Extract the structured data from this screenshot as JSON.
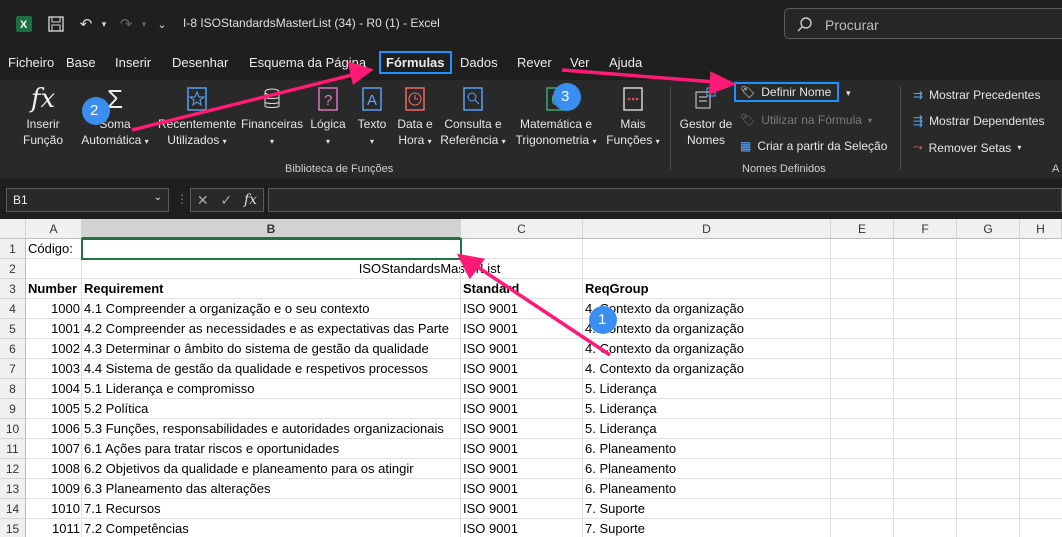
{
  "titlebar": {
    "title": "I-8 ISOStandardsMasterList (34) - R0 (1)  -  Excel",
    "search_placeholder": "Procurar"
  },
  "tabs": [
    "Ficheiro",
    "Base",
    "Inserir",
    "Desenhar",
    "Esquema da Página",
    "Fórmulas",
    "Dados",
    "Rever",
    "Ver",
    "Ajuda"
  ],
  "ribbon": {
    "insert_function": [
      "Inserir",
      "Função"
    ],
    "autosum": [
      "Soma",
      "Automática"
    ],
    "recent": [
      "Recentemente",
      "Utilizados"
    ],
    "financial": "Financeiras",
    "logical": "Lógica",
    "text": "Texto",
    "datetime": [
      "Data e",
      "Hora"
    ],
    "lookup": [
      "Consulta e",
      "Referência"
    ],
    "math": [
      "Matemática e",
      "Trigonometria"
    ],
    "more": [
      "Mais",
      "Funções"
    ],
    "group_library": "Biblioteca de Funções",
    "name_manager": [
      "Gestor de",
      "Nomes"
    ],
    "define_name": "Definir Nome",
    "use_in_formula": "Utilizar na Fórmula",
    "create_from_selection": "Criar a partir da Seleção",
    "group_names": "Nomes Definidos",
    "trace_precedents": "Mostrar Precedentes",
    "trace_dependents": "Mostrar Dependentes",
    "remove_arrows": "Remover Setas",
    "group_audit_partial": "A"
  },
  "formula_bar": {
    "name_box": "B1",
    "fx": "fx"
  },
  "columns": [
    "A",
    "B",
    "C",
    "D",
    "E",
    "F",
    "G",
    "H"
  ],
  "rows": [
    {
      "n": "1",
      "a": "Código:",
      "b": "",
      "c": "",
      "d": ""
    },
    {
      "n": "2",
      "a": "",
      "b": "ISOStandardsMasterList",
      "c": "",
      "d": ""
    },
    {
      "n": "3",
      "a": "Number",
      "b": "Requirement",
      "c": "Standard",
      "d": "ReqGroup"
    },
    {
      "n": "4",
      "a": "1000",
      "b": "4.1 Compreender a organização e o seu contexto",
      "c": "ISO 9001",
      "d": "4. Contexto da organização"
    },
    {
      "n": "5",
      "a": "1001",
      "b": "4.2 Compreender  as necessidades e as expectativas das Parte",
      "c": "ISO 9001",
      "d": "4. Contexto da organização"
    },
    {
      "n": "6",
      "a": "1002",
      "b": "4.3 Determinar o âmbito do sistema de gestão da qualidade",
      "c": "ISO 9001",
      "d": "4. Contexto da organização"
    },
    {
      "n": "7",
      "a": "1003",
      "b": "4.4 Sistema de gestão da qualidade e respetivos processos",
      "c": "ISO 9001",
      "d": "4. Contexto da organização"
    },
    {
      "n": "8",
      "a": "1004",
      "b": "5.1 Liderança e compromisso",
      "c": "ISO 9001",
      "d": "5. Liderança"
    },
    {
      "n": "9",
      "a": "1005",
      "b": "5.2 Política",
      "c": "ISO 9001",
      "d": "5. Liderança"
    },
    {
      "n": "10",
      "a": "1006",
      "b": "5.3 Funções, responsabilidades e autoridades organizacionais",
      "c": "ISO 9001",
      "d": "5. Liderança"
    },
    {
      "n": "11",
      "a": "1007",
      "b": "6.1 Ações para tratar riscos e oportunidades",
      "c": "ISO 9001",
      "d": "6. Planeamento"
    },
    {
      "n": "12",
      "a": "1008",
      "b": "6.2 Objetivos da qualidade e planeamento para os atingir",
      "c": "ISO 9001",
      "d": "6. Planeamento"
    },
    {
      "n": "13",
      "a": "1009",
      "b": "6.3 Planeamento das alterações",
      "c": "ISO 9001",
      "d": "6. Planeamento"
    },
    {
      "n": "14",
      "a": "1010",
      "b": "7.1 Recursos",
      "c": "ISO 9001",
      "d": "7. Suporte"
    },
    {
      "n": "15",
      "a": "1011",
      "b": "7.2 Competências",
      "c": "ISO 9001",
      "d": "7. Suporte"
    }
  ],
  "callouts": [
    "1",
    "2",
    "3"
  ],
  "colors": {
    "accent": "#1e90ff",
    "arrow": "#ff1a75",
    "excel_green": "#217346"
  }
}
